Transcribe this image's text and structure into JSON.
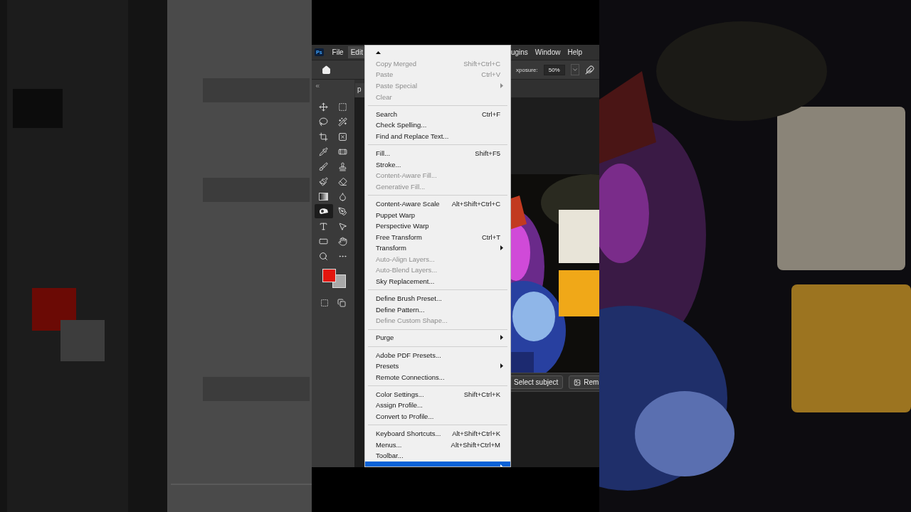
{
  "menu_bar": {
    "logo": "Ps",
    "items": [
      {
        "label": "File",
        "selected": false
      },
      {
        "label": "Edit",
        "selected": true
      }
    ],
    "right_items": [
      {
        "label": "ugins",
        "selected": false
      },
      {
        "label": "Window",
        "selected": false
      },
      {
        "label": "Help",
        "selected": false
      }
    ]
  },
  "options_bar": {
    "exposure_label": "xposure:",
    "exposure_value": "50%"
  },
  "document_tab": {
    "label": "p"
  },
  "tools": [
    {
      "selected": false
    },
    {
      "selected": false
    },
    {
      "selected": false
    },
    {
      "selected": false
    },
    {
      "selected": false
    },
    {
      "selected": false
    },
    {
      "selected": false
    },
    {
      "selected": false
    },
    {
      "selected": false
    },
    {
      "selected": false
    },
    {
      "selected": false
    },
    {
      "selected": false
    },
    {
      "selected": false
    },
    {
      "selected": false
    },
    {
      "selected": true
    },
    {
      "selected": false
    },
    {
      "selected": false
    },
    {
      "selected": false
    },
    {
      "selected": false
    },
    {
      "selected": false
    },
    {
      "selected": false
    },
    {
      "selected": false
    }
  ],
  "contextual_bar": {
    "buttons": [
      "Select subject",
      "Rem"
    ]
  },
  "edit_menu": [
    {
      "kind": "scroll"
    },
    {
      "kind": "item",
      "label": "Copy Merged",
      "shortcut": "Shift+Ctrl+C",
      "disabled": true,
      "submenu": false,
      "selected": false
    },
    {
      "kind": "item",
      "label": "Paste",
      "shortcut": "Ctrl+V",
      "disabled": true,
      "submenu": false,
      "selected": false
    },
    {
      "kind": "item",
      "label": "Paste Special",
      "disabled": true,
      "submenu": true,
      "selected": false
    },
    {
      "kind": "item",
      "label": "Clear",
      "disabled": true,
      "submenu": false,
      "selected": false
    },
    {
      "kind": "separator"
    },
    {
      "kind": "item",
      "label": "Search",
      "shortcut": "Ctrl+F",
      "disabled": false,
      "submenu": false,
      "selected": false
    },
    {
      "kind": "item",
      "label": "Check Spelling...",
      "disabled": false,
      "submenu": false,
      "selected": false
    },
    {
      "kind": "item",
      "label": "Find and Replace Text...",
      "disabled": false,
      "submenu": false,
      "selected": false
    },
    {
      "kind": "separator"
    },
    {
      "kind": "item",
      "label": "Fill...",
      "shortcut": "Shift+F5",
      "disabled": false,
      "submenu": false,
      "selected": false
    },
    {
      "kind": "item",
      "label": "Stroke...",
      "disabled": false,
      "submenu": false,
      "selected": false
    },
    {
      "kind": "item",
      "label": "Content-Aware Fill...",
      "disabled": true,
      "submenu": false,
      "selected": false
    },
    {
      "kind": "item",
      "label": "Generative Fill...",
      "disabled": true,
      "submenu": false,
      "selected": false
    },
    {
      "kind": "separator"
    },
    {
      "kind": "item",
      "label": "Content-Aware Scale",
      "shortcut": "Alt+Shift+Ctrl+C",
      "disabled": false,
      "submenu": false,
      "selected": false
    },
    {
      "kind": "item",
      "label": "Puppet Warp",
      "disabled": false,
      "submenu": false,
      "selected": false
    },
    {
      "kind": "item",
      "label": "Perspective Warp",
      "disabled": false,
      "submenu": false,
      "selected": false
    },
    {
      "kind": "item",
      "label": "Free Transform",
      "shortcut": "Ctrl+T",
      "disabled": false,
      "submenu": false,
      "selected": false
    },
    {
      "kind": "item",
      "label": "Transform",
      "disabled": false,
      "submenu": true,
      "selected": false
    },
    {
      "kind": "item",
      "label": "Auto-Align Layers...",
      "disabled": true,
      "submenu": false,
      "selected": false
    },
    {
      "kind": "item",
      "label": "Auto-Blend Layers...",
      "disabled": true,
      "submenu": false,
      "selected": false
    },
    {
      "kind": "item",
      "label": "Sky Replacement...",
      "disabled": false,
      "submenu": false,
      "selected": false
    },
    {
      "kind": "separator"
    },
    {
      "kind": "item",
      "label": "Define Brush Preset...",
      "disabled": false,
      "submenu": false,
      "selected": false
    },
    {
      "kind": "item",
      "label": "Define Pattern...",
      "disabled": false,
      "submenu": false,
      "selected": false
    },
    {
      "kind": "item",
      "label": "Define Custom Shape...",
      "disabled": true,
      "submenu": false,
      "selected": false
    },
    {
      "kind": "separator"
    },
    {
      "kind": "item",
      "label": "Purge",
      "disabled": false,
      "submenu": true,
      "selected": false
    },
    {
      "kind": "separator"
    },
    {
      "kind": "item",
      "label": "Adobe PDF Presets...",
      "disabled": false,
      "submenu": false,
      "selected": false
    },
    {
      "kind": "item",
      "label": "Presets",
      "disabled": false,
      "submenu": true,
      "selected": false
    },
    {
      "kind": "item",
      "label": "Remote Connections...",
      "disabled": false,
      "submenu": false,
      "selected": false
    },
    {
      "kind": "separator"
    },
    {
      "kind": "item",
      "label": "Color Settings...",
      "shortcut": "Shift+Ctrl+K",
      "disabled": false,
      "submenu": false,
      "selected": false
    },
    {
      "kind": "item",
      "label": "Assign Profile...",
      "disabled": false,
      "submenu": false,
      "selected": false
    },
    {
      "kind": "item",
      "label": "Convert to Profile...",
      "disabled": false,
      "submenu": false,
      "selected": false
    },
    {
      "kind": "separator"
    },
    {
      "kind": "item",
      "label": "Keyboard Shortcuts...",
      "shortcut": "Alt+Shift+Ctrl+K",
      "disabled": false,
      "submenu": false,
      "selected": false
    },
    {
      "kind": "item",
      "label": "Menus...",
      "shortcut": "Alt+Shift+Ctrl+M",
      "disabled": false,
      "submenu": false,
      "selected": false
    },
    {
      "kind": "item",
      "label": "Toolbar...",
      "disabled": false,
      "submenu": false,
      "selected": false
    },
    {
      "kind": "item",
      "disabled": false,
      "submenu": true,
      "selected": true
    }
  ]
}
